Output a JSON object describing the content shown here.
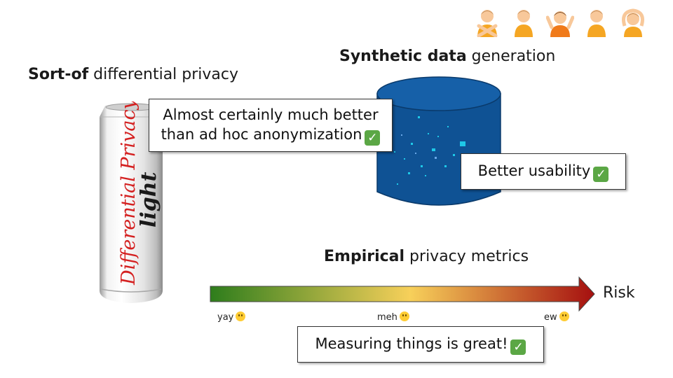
{
  "header": {
    "people": [
      {
        "icon": "no-gesture-person-icon",
        "color": "#f5a623"
      },
      {
        "icon": "standing-person-icon",
        "color": "#f5a623"
      },
      {
        "icon": "shrugging-person-icon",
        "color": "#f07a1a"
      },
      {
        "icon": "person-icon",
        "color": "#f5a623"
      },
      {
        "icon": "ok-gesture-person-icon",
        "color": "#f5a623"
      }
    ]
  },
  "sections": {
    "dp": {
      "bold": "Sort-of",
      "rest": " differential privacy"
    },
    "synthetic": {
      "bold": "Synthetic data",
      "rest": " generation"
    },
    "empirical": {
      "bold": "Empirical",
      "rest": " privacy metrics"
    }
  },
  "can": {
    "script_text": "Differential Privacy",
    "light_text": "light"
  },
  "callouts": {
    "dp_line1": "Almost certainly much better",
    "dp_line2": "than ad hoc anonymization",
    "synthetic": "Better usability",
    "measuring": "Measuring things is great!"
  },
  "scale": {
    "risk_label": "Risk",
    "yay": "yay",
    "meh": "meh",
    "ew": "ew",
    "colors": {
      "low": "#2e7d1c",
      "mid": "#f7d05a",
      "high": "#a50f0f"
    }
  }
}
